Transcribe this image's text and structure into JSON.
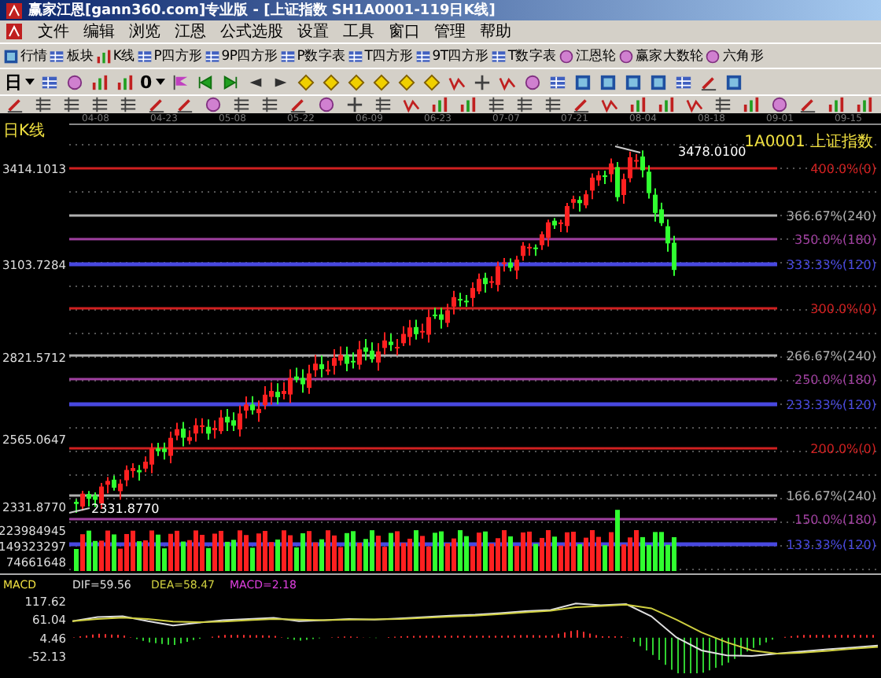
{
  "window": {
    "title": "赢家江恩[gann360.com]专业版 - [上证指数   SH1A0001-119日K线]"
  },
  "menu": [
    "文件",
    "编辑",
    "浏览",
    "江恩",
    "公式选股",
    "设置",
    "工具",
    "窗口",
    "管理",
    "帮助"
  ],
  "toolbar": [
    "行情",
    "板块",
    "K线",
    "P四方形",
    "9P四方形",
    "P数字表",
    "T四方形",
    "9T四方形",
    "T数字表",
    "江恩轮",
    "赢家大数轮",
    "六角形"
  ],
  "period_dropdown": {
    "value": "日"
  },
  "count_dropdown": {
    "value": "0"
  },
  "chart": {
    "period_label": "日K线",
    "symbol": "1A0001 上证指数",
    "dates": [
      "04-08",
      "04-23",
      "05-08",
      "05-22",
      "06-09",
      "06-23",
      "07-07",
      "07-21",
      "08-04",
      "08-18",
      "09-01",
      "09-15"
    ],
    "price_labels": [
      "3414.1013",
      "3103.7284",
      "2821.5712",
      "2565.0647",
      "2331.8770"
    ],
    "levels": [
      {
        "label": "400.0%(0)",
        "color": "#d02020"
      },
      {
        "label": "366.67%(240)",
        "color": "#b0b0b0"
      },
      {
        "label": "350.0%(180)",
        "color": "#a040a0"
      },
      {
        "label": "333.33%(120)",
        "color": "#4848e0"
      },
      {
        "label": "300.0%(0)",
        "color": "#d02020"
      },
      {
        "label": "266.67%(240)",
        "color": "#b0b0b0"
      },
      {
        "label": "250.0%(180)",
        "color": "#a040a0"
      },
      {
        "label": "233.33%(120)",
        "color": "#4848e0"
      },
      {
        "label": "200.0%(0)",
        "color": "#d02020"
      },
      {
        "label": "166.67%(240)",
        "color": "#b0b0b0"
      },
      {
        "label": "150.0%(180)",
        "color": "#a040a0"
      },
      {
        "label": "133.33%(120)",
        "color": "#4848e0"
      }
    ],
    "high_note": "3478.0100",
    "low_note": "2331.8770",
    "volume_labels": [
      "223984945",
      "149323297",
      "74661648"
    ]
  },
  "macd": {
    "title": "MACD",
    "dif": "DIF=59.56",
    "dea": "DEA=58.47",
    "macd": "MACD=2.18",
    "chart_data": {
      "type": "line",
      "ylim": [
        -52.13,
        117.62
      ],
      "yticks": [
        117.62,
        61.04,
        4.46,
        -52.13
      ],
      "series": [
        {
          "color": "#e0e0e0",
          "values": [
            55,
            68,
            70,
            55,
            42,
            50,
            58,
            62,
            65,
            55,
            58,
            62,
            60,
            64,
            68,
            72,
            75,
            80,
            86,
            90,
            110,
            104,
            108,
            70,
            5,
            -35,
            -50,
            -52,
            -45,
            -38,
            -32,
            -26,
            -20
          ]
        },
        {
          "color": "#d0d040",
          "values": [
            55,
            62,
            66,
            62,
            54,
            52,
            54,
            58,
            62,
            60,
            58,
            60,
            61,
            62,
            65,
            69,
            72,
            77,
            82,
            87,
            98,
            102,
            106,
            95,
            60,
            20,
            -10,
            -35,
            -45,
            -42,
            -36,
            -30,
            -24
          ]
        }
      ]
    }
  }
}
